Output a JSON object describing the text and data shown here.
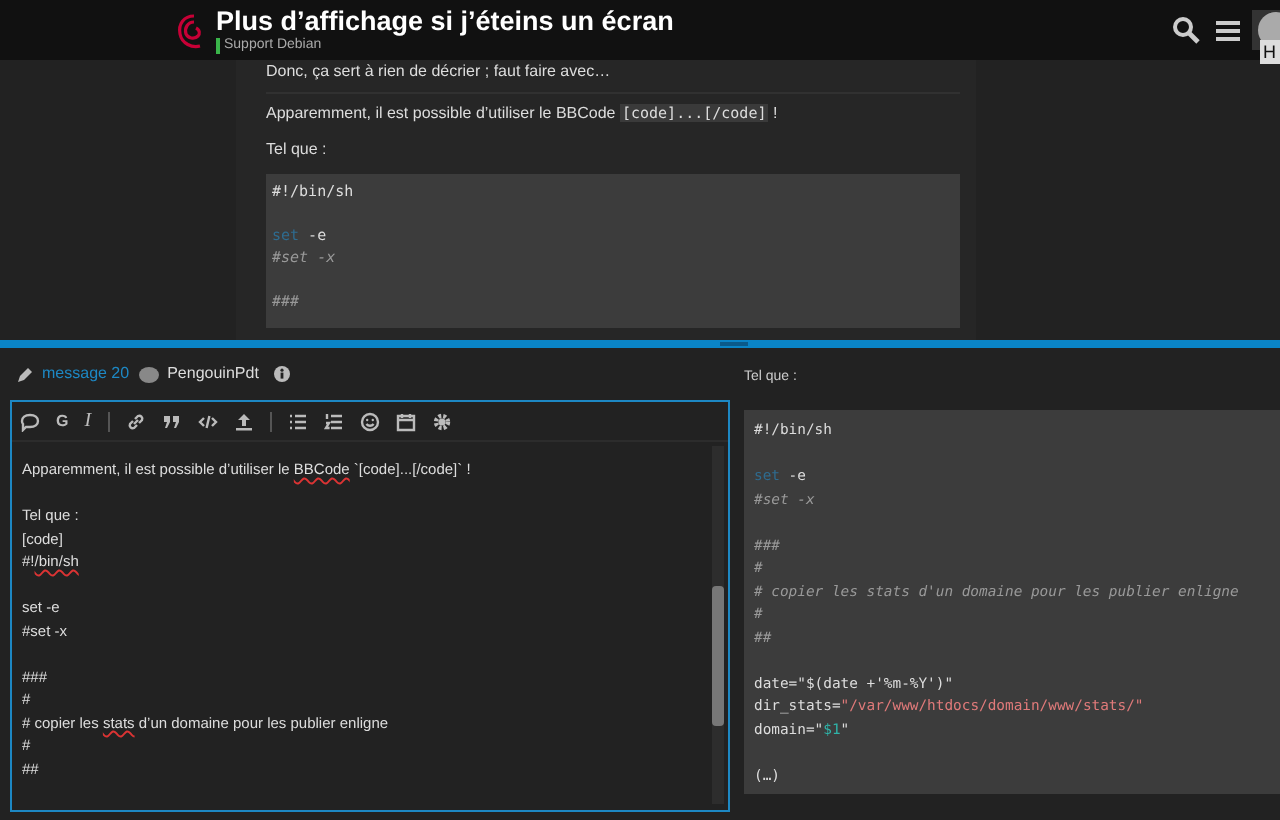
{
  "header": {
    "title": "Plus d’affichage si j’éteins un écran",
    "category": "Support Debian",
    "tooltip": "H"
  },
  "post": {
    "cut_line": "Donc, ça sert à rien de décrier ; faut faire avec…",
    "paragraph": [
      {
        "text": "Apparemment, il est possible d’utiliser le BBCode ",
        "code": false
      },
      {
        "text": "[code]...[/code]",
        "code": true
      },
      {
        "text": " !",
        "code": false
      }
    ],
    "intro": "Tel que :",
    "code": [
      {
        "spaced": false,
        "tokens": [
          {
            "text": "#!/bin/sh",
            "kind": "plain"
          }
        ]
      },
      {
        "spaced": true,
        "tokens": [
          {
            "text": "set",
            "kind": "keyword"
          },
          {
            "text": " -e",
            "kind": "plain"
          }
        ]
      },
      {
        "spaced": false,
        "tokens": [
          {
            "text": "#set -x",
            "kind": "comment"
          }
        ]
      },
      {
        "spaced": true,
        "tokens": [
          {
            "text": "###",
            "kind": "comment"
          }
        ]
      }
    ]
  },
  "reply": {
    "action": "message 20",
    "user": "PengouinPdt"
  },
  "toolbar": {
    "bold_label": "G",
    "italic_label": "I"
  },
  "editor_lines": [
    {
      "spaced": false,
      "segments": [
        {
          "text": "Apparemment, il est possible d’utiliser le ",
          "misspelled": false
        },
        {
          "text": "BBCode",
          "misspelled": true
        },
        {
          "text": " `[code]...[/code]` !",
          "misspelled": false
        }
      ]
    },
    {
      "spaced": true,
      "segments": [
        {
          "text": "Tel que :",
          "misspelled": false
        }
      ]
    },
    {
      "spaced": false,
      "segments": [
        {
          "text": "[code]",
          "misspelled": false
        }
      ]
    },
    {
      "spaced": false,
      "segments": [
        {
          "text": "#!",
          "misspelled": false
        },
        {
          "text": "/bin/sh",
          "misspelled": true
        }
      ]
    },
    {
      "spaced": true,
      "segments": [
        {
          "text": "set -e",
          "misspelled": false
        }
      ]
    },
    {
      "spaced": false,
      "segments": [
        {
          "text": "#set -x",
          "misspelled": false
        }
      ]
    },
    {
      "spaced": true,
      "segments": [
        {
          "text": "###",
          "misspelled": false
        }
      ]
    },
    {
      "spaced": false,
      "segments": [
        {
          "text": "#",
          "misspelled": false
        }
      ]
    },
    {
      "spaced": false,
      "segments": [
        {
          "text": "# copier les ",
          "misspelled": false
        },
        {
          "text": "stats",
          "misspelled": true
        },
        {
          "text": " d’un domaine pour les publier enligne",
          "misspelled": false
        }
      ]
    },
    {
      "spaced": false,
      "segments": [
        {
          "text": "#",
          "misspelled": false
        }
      ]
    },
    {
      "spaced": false,
      "segments": [
        {
          "text": "##",
          "misspelled": false
        }
      ]
    }
  ],
  "preview": {
    "cut_line": "Tel que :",
    "code": [
      {
        "spaced": false,
        "tokens": [
          {
            "text": "#!/bin/sh",
            "kind": "plain"
          }
        ]
      },
      {
        "spaced": true,
        "tokens": [
          {
            "text": "set",
            "kind": "keyword"
          },
          {
            "text": " -e",
            "kind": "plain"
          }
        ]
      },
      {
        "spaced": false,
        "tokens": [
          {
            "text": "#set -x",
            "kind": "comment"
          }
        ]
      },
      {
        "spaced": true,
        "tokens": [
          {
            "text": "###",
            "kind": "comment"
          }
        ]
      },
      {
        "spaced": false,
        "tokens": [
          {
            "text": "#",
            "kind": "comment"
          }
        ]
      },
      {
        "spaced": false,
        "tokens": [
          {
            "text": "# copier les stats d'un domaine pour les publier enligne",
            "kind": "comment"
          }
        ]
      },
      {
        "spaced": false,
        "tokens": [
          {
            "text": "#",
            "kind": "comment"
          }
        ]
      },
      {
        "spaced": false,
        "tokens": [
          {
            "text": "##",
            "kind": "comment"
          }
        ]
      },
      {
        "spaced": true,
        "tokens": [
          {
            "text": "date=\"$(date +'%m-%Y')\"",
            "kind": "plain"
          }
        ]
      },
      {
        "spaced": false,
        "tokens": [
          {
            "text": "dir_stats=",
            "kind": "plain"
          },
          {
            "text": "\"/var/www/htdocs/domain/www/stats/\"",
            "kind": "string"
          }
        ]
      },
      {
        "spaced": false,
        "tokens": [
          {
            "text": "domain=\"",
            "kind": "plain"
          },
          {
            "text": "$1",
            "kind": "variable"
          },
          {
            "text": "\"",
            "kind": "plain"
          }
        ]
      },
      {
        "spaced": true,
        "tokens": [
          {
            "text": "(…)",
            "kind": "plain"
          }
        ]
      }
    ]
  }
}
